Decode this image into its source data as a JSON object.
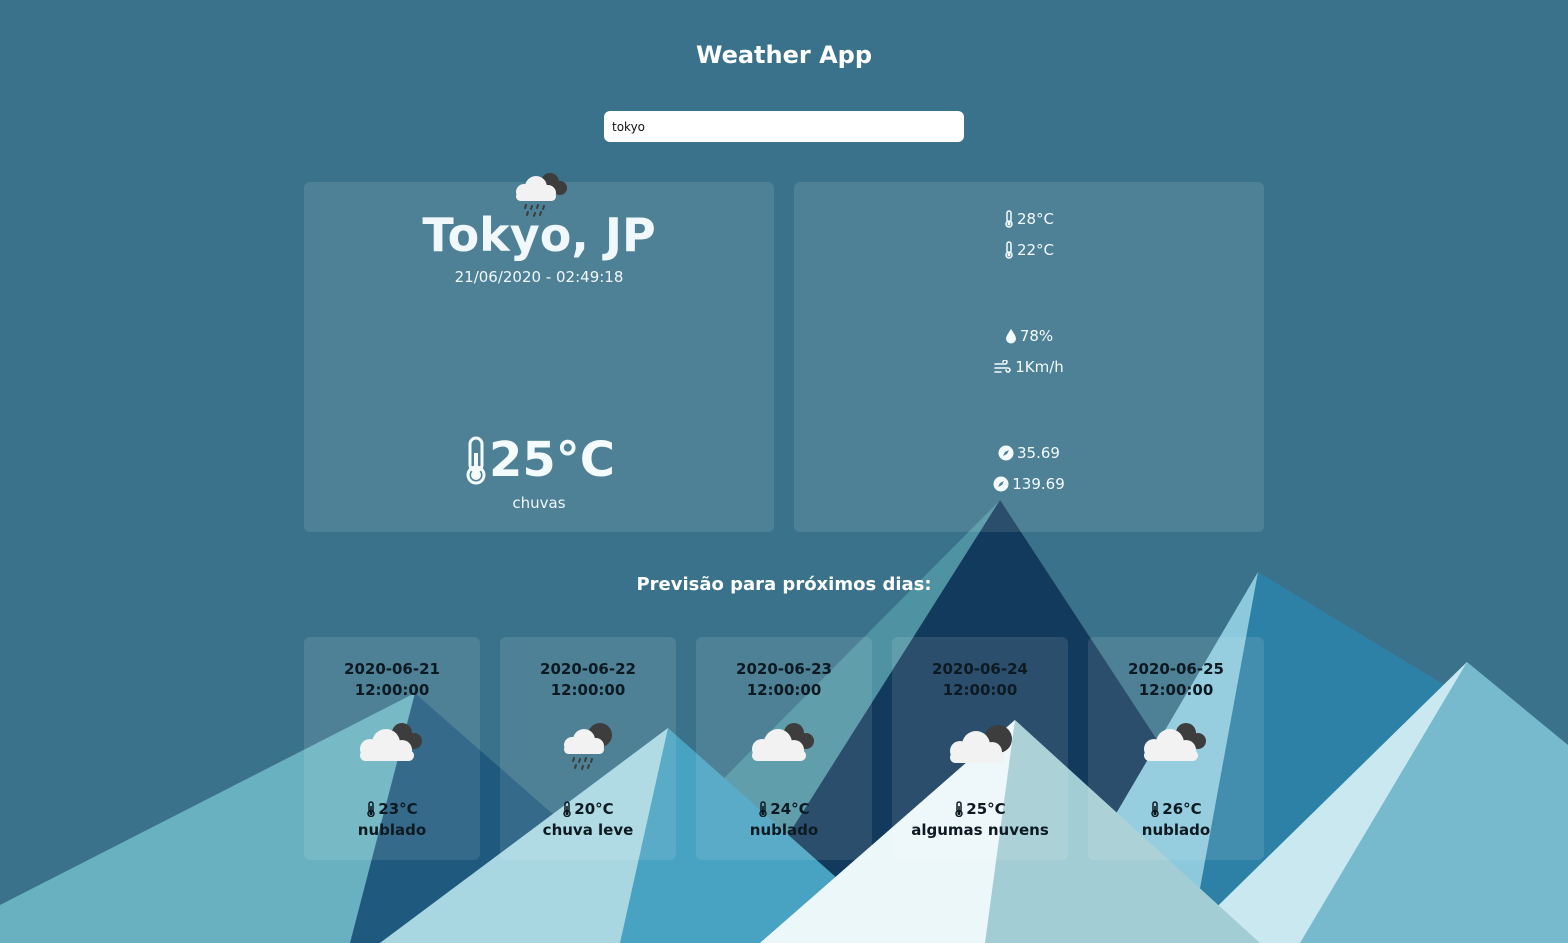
{
  "app": {
    "title": "Weather App"
  },
  "search": {
    "value": "tokyo"
  },
  "current": {
    "city": "Tokyo, JP",
    "datetime": "21/06/2020 - 02:49:18",
    "icon": "rain-cloud-icon",
    "temp": "25°C",
    "condition": "chuvas"
  },
  "details": {
    "temp_max": "28°C",
    "temp_min": "22°C",
    "humidity": "78%",
    "wind": "1Km/h",
    "lat": "35.69",
    "lon": "139.69"
  },
  "forecast": {
    "title": "Previsão para próximos dias:",
    "days": [
      {
        "date": "2020-06-21",
        "time": "12:00:00",
        "icon": "overcast-cloud-icon",
        "temp": "23°C",
        "desc": "nublado"
      },
      {
        "date": "2020-06-22",
        "time": "12:00:00",
        "icon": "rain-cloud-icon",
        "temp": "20°C",
        "desc": "chuva leve"
      },
      {
        "date": "2020-06-23",
        "time": "12:00:00",
        "icon": "overcast-cloud-icon",
        "temp": "24°C",
        "desc": "nublado"
      },
      {
        "date": "2020-06-24",
        "time": "12:00:00",
        "icon": "broken-cloud-icon",
        "temp": "25°C",
        "desc": "algumas nuvens"
      },
      {
        "date": "2020-06-25",
        "time": "12:00:00",
        "icon": "overcast-cloud-icon",
        "temp": "26°C",
        "desc": "nublado"
      }
    ]
  },
  "colors": {
    "background": "#3a728b",
    "panel": "rgba(255,255,255,0.1)",
    "text_light": "#ffffff",
    "text_dark": "#0d1a22"
  }
}
